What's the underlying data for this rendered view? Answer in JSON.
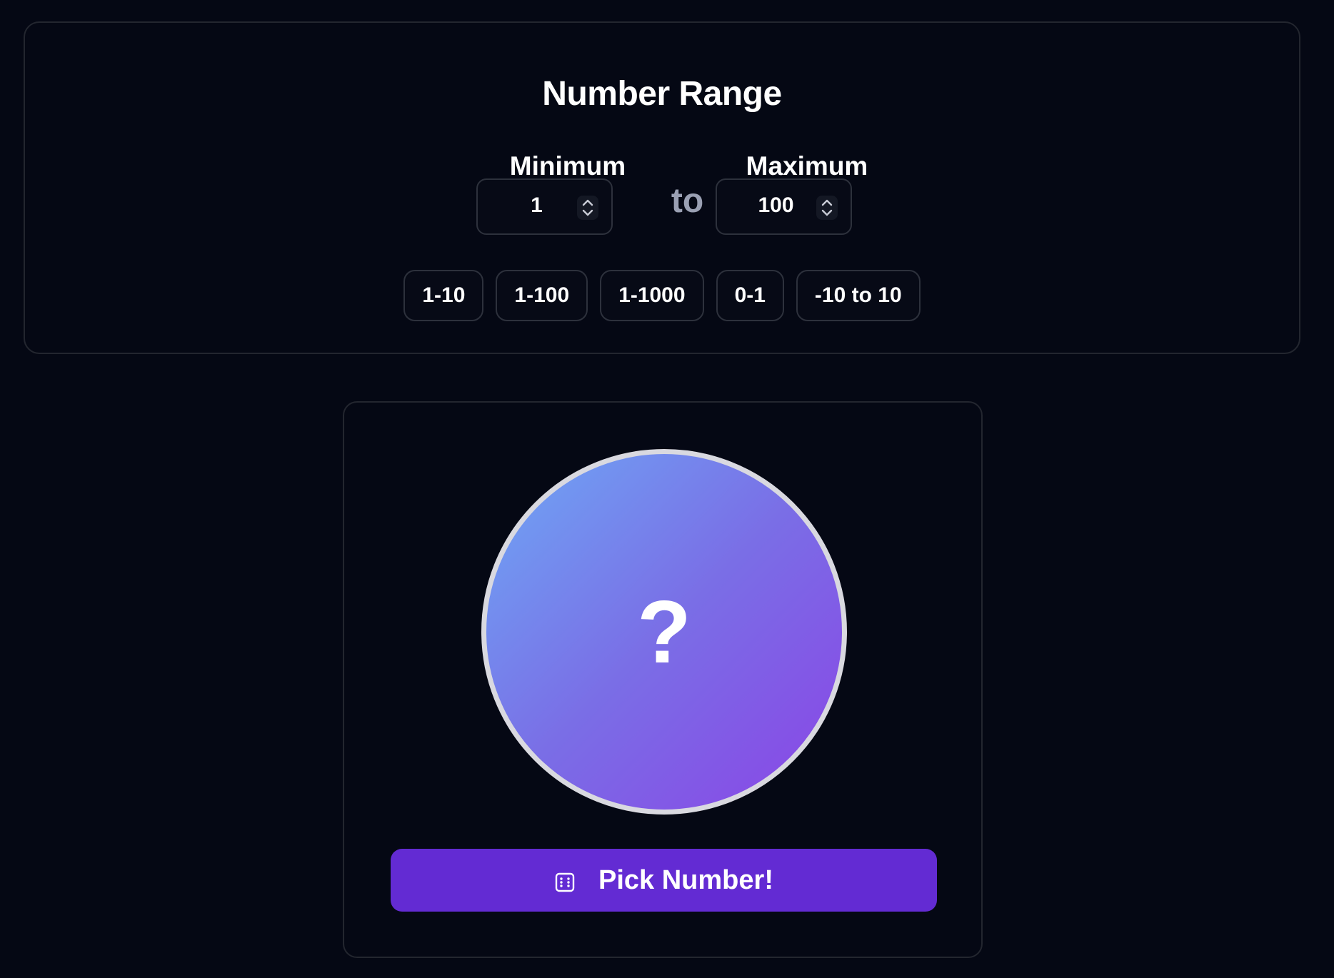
{
  "range": {
    "title": "Number Range",
    "min_label": "Minimum",
    "max_label": "Maximum",
    "separator": "to",
    "min_value": "1",
    "max_value": "100",
    "presets": [
      "1-10",
      "1-100",
      "1-1000",
      "0-1",
      "-10 to 10"
    ]
  },
  "picker": {
    "result": "?",
    "button_label": "Pick Number!",
    "button_icon": "dice-icon"
  },
  "colors": {
    "background": "#050814",
    "button": "#632bd3",
    "circle_start": "#6ea8f5",
    "circle_end": "#8a44e6",
    "separator_text": "#9aa0b3"
  }
}
